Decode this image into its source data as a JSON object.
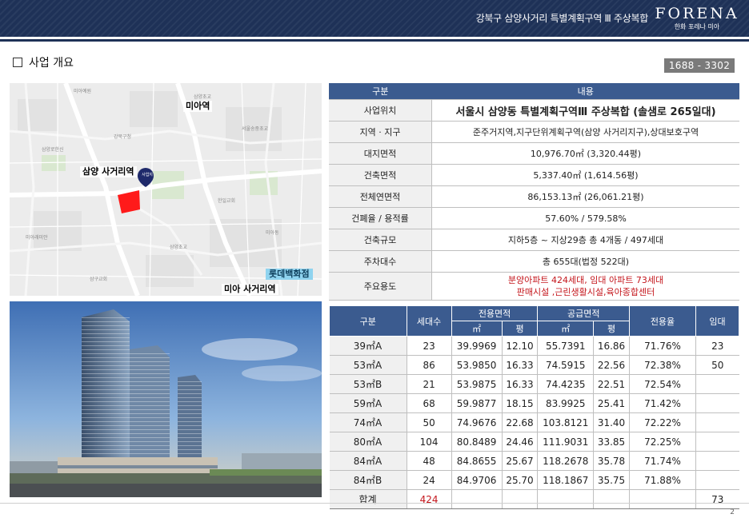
{
  "header": {
    "subtitle": "강북구 삼양사거리 특별계획구역 Ⅲ 주상복합",
    "brand_logo": "FORENA",
    "brand_sub": "한화 포레나 미아"
  },
  "section": {
    "title": "사업 개요",
    "phone": "1688 - 3302"
  },
  "map": {
    "labels": {
      "mia_station": "미아역",
      "samyang_intersection": "삼양 사거리역",
      "lotte": "롯데백화점",
      "mia_intersection": "미아 사거리역",
      "site_pin": "사업지"
    }
  },
  "overview": {
    "headers": [
      "구분",
      "내용"
    ],
    "rows": [
      {
        "label": "사업위치",
        "value": "서울시  삼양동 특별계획구역Ⅲ 주상복합 (솔샘로 265일대)"
      },
      {
        "label": "지역 · 지구",
        "value": "준주거지역,지구단위계획구역(삼양 사거리지구),상대보호구역"
      },
      {
        "label": "대지면적",
        "value": "10,976.70㎡ (3,320.44평)"
      },
      {
        "label": "건축면적",
        "value": "5,337.40㎡ (1,614.56평)"
      },
      {
        "label": "전체연면적",
        "value": "86,153.13㎡ (26,061.21평)"
      },
      {
        "label": "건폐율 / 용적률",
        "value": "57.60% / 579.58%"
      },
      {
        "label": "건축규모",
        "value": "지하5층 ~ 지상29층 총 4개동 /   497세대"
      },
      {
        "label": "주차대수",
        "value": "총 655대(법정 522대)"
      },
      {
        "label": "주요용도",
        "value_line1": "분양아파트 424세대,  임대 아파트 73세대",
        "value_line2": "판매시설 ,근린생활시설,육아종합센터"
      }
    ]
  },
  "units": {
    "headers": {
      "type": "구분",
      "households": "세대수",
      "exclusive": "전용면적",
      "supply": "공급면적",
      "ratio": "전용율",
      "rental": "임대",
      "m2": "㎡",
      "pyeong": "평"
    },
    "rows": [
      {
        "type": "39㎡A",
        "households": "23",
        "ex_m2": "39.9969",
        "ex_py": "12.10",
        "sup_m2": "55.7391",
        "sup_py": "16.86",
        "ratio": "71.76%",
        "rental": "23"
      },
      {
        "type": "53㎡A",
        "households": "86",
        "ex_m2": "53.9850",
        "ex_py": "16.33",
        "sup_m2": "74.5915",
        "sup_py": "22.56",
        "ratio": "72.38%",
        "rental": "50"
      },
      {
        "type": "53㎡B",
        "households": "21",
        "ex_m2": "53.9875",
        "ex_py": "16.33",
        "sup_m2": "74.4235",
        "sup_py": "22.51",
        "ratio": "72.54%",
        "rental": ""
      },
      {
        "type": "59㎡A",
        "households": "68",
        "ex_m2": "59.9877",
        "ex_py": "18.15",
        "sup_m2": "83.9925",
        "sup_py": "25.41",
        "ratio": "71.42%",
        "rental": ""
      },
      {
        "type": "74㎡A",
        "households": "50",
        "ex_m2": "74.9676",
        "ex_py": "22.68",
        "sup_m2": "103.8121",
        "sup_py": "31.40",
        "ratio": "72.22%",
        "rental": ""
      },
      {
        "type": "80㎡A",
        "households": "104",
        "ex_m2": "80.8489",
        "ex_py": "24.46",
        "sup_m2": "111.9031",
        "sup_py": "33.85",
        "ratio": "72.25%",
        "rental": ""
      },
      {
        "type": "84㎡A",
        "households": "48",
        "ex_m2": "84.8655",
        "ex_py": "25.67",
        "sup_m2": "118.2678",
        "sup_py": "35.78",
        "ratio": "71.74%",
        "rental": ""
      },
      {
        "type": "84㎡B",
        "households": "24",
        "ex_m2": "84.9706",
        "ex_py": "25.70",
        "sup_m2": "118.1867",
        "sup_py": "35.75",
        "ratio": "71.88%",
        "rental": ""
      }
    ],
    "total": {
      "type": "합계",
      "households": "424",
      "rental": "73"
    }
  },
  "page_number": "2",
  "colors": {
    "navy": "#1e3157",
    "table_header": "#3b5b8f",
    "red": "#c4161c",
    "site_red": "#ff1a1a"
  }
}
